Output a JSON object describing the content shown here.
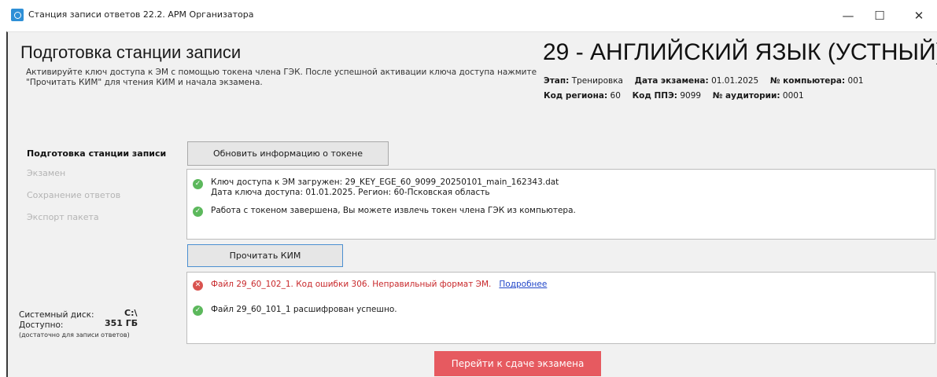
{
  "window": {
    "title": "Станция записи ответов 22.2. АРМ Организатора",
    "minimize_glyph": "—",
    "maximize_glyph": "☐",
    "close_glyph": "✕"
  },
  "header": {
    "title": "Подготовка станции записи",
    "description": "Активируйте ключ доступа к ЭМ с помощью токена члена ГЭК. После успешной активации ключа доступа нажмите \"Прочитать КИМ\" для чтения КИМ и начала экзамена.",
    "exam_title": "29 - АНГЛИЙСКИЙ ЯЗЫК (УСТНЫЙ)",
    "meta": {
      "stage_label": "Этап:",
      "stage_value": "Тренировка",
      "date_label": "Дата экзамена:",
      "date_value": "01.01.2025",
      "computer_label": "№ компьютера:",
      "computer_value": "001",
      "region_label": "Код региона:",
      "region_value": "60",
      "ppe_label": "Код ППЭ:",
      "ppe_value": "9099",
      "room_label": "№ аудитории:",
      "room_value": "0001"
    }
  },
  "sidebar": {
    "items": [
      {
        "label": "Подготовка станции записи",
        "active": true
      },
      {
        "label": "Экзамен",
        "active": false
      },
      {
        "label": "Сохранение ответов",
        "active": false
      },
      {
        "label": "Экспорт пакета",
        "active": false
      }
    ],
    "disk": {
      "system_label": "Системный диск:",
      "system_value": "C:\\",
      "available_label": "Доступно:",
      "available_value": "351 ГБ",
      "note": "(достаточно для записи ответов)"
    }
  },
  "main": {
    "refresh_token_button": "Обновить информацию о токене",
    "token_messages": [
      {
        "status": "ok",
        "line1": "Ключ доступа к ЭМ загружен: 29_KEY_EGE_60_9099_20250101_main_162343.dat",
        "line2": "Дата ключа доступа: 01.01.2025. Регион: 60-Псковская область"
      },
      {
        "status": "ok",
        "line1": "Работа с токеном завершена, Вы можете извлечь токен члена ГЭК из компьютера."
      }
    ],
    "read_kim_button": "Прочитать КИМ",
    "kim_messages": [
      {
        "status": "error",
        "text": "Файл 29_60_102_1. Код ошибки 306. Неправильный формат ЭМ.",
        "link": "Подробнее"
      },
      {
        "status": "ok",
        "text": "Файл 29_60_101_1 расшифрован успешно."
      }
    ],
    "go_exam_button": "Перейти к сдаче экзамена"
  },
  "icons": {
    "ok": "check-circle-icon",
    "error": "error-circle-icon"
  },
  "colors": {
    "ok": "#5cb85c",
    "error": "#d9534f",
    "error_text": "#c8282b",
    "link": "#2247c9",
    "primary_button": "#e65a60",
    "focus_border": "#4b8fd1"
  }
}
